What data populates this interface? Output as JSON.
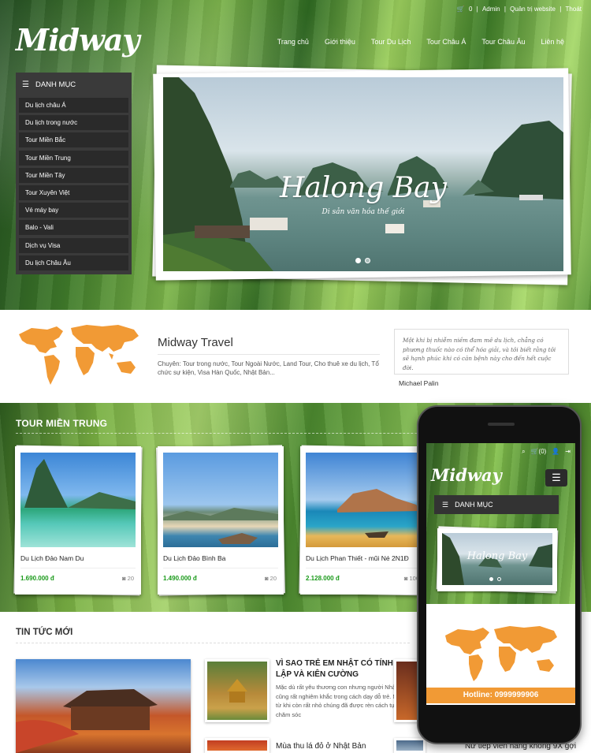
{
  "brand": {
    "logo": "Midway"
  },
  "topbar": {
    "cart_count": "0",
    "admin": "Admin",
    "site_admin": "Quản trị website",
    "logout": "Thoát"
  },
  "nav": [
    "Trang chủ",
    "Giới thiệu",
    "Tour Du Lịch",
    "Tour Châu Á",
    "Tour Châu Âu",
    "Liên hệ"
  ],
  "sidebar": {
    "title": "DANH MỤC",
    "items": [
      "Du lịch châu Á",
      "Du lịch trong nước",
      "Tour Miền Bắc",
      "Tour Miền Trung",
      "Tour Miền Tây",
      "Tour Xuyên Việt",
      "Vé máy bay",
      "Balo - Vali",
      "Dịch vụ Visa",
      "Du lịch Châu Âu"
    ]
  },
  "slider": {
    "title": "Halong Bay",
    "subtitle": "Di sản văn hóa thế giới"
  },
  "about": {
    "name": "Midway Travel",
    "desc": "Chuyên: Tour trong nước, Tour Ngoài Nước, Land Tour, Cho thuê xe du lịch, Tổ chức sự kiện, Visa Hàn Quốc, Nhật Bản..."
  },
  "quote": {
    "text": "Một khi bị nhiễm niềm đam mê du lịch, chẳng có phương thuốc nào có thể hóa giải, và tôi biết rằng tôi sẽ hạnh phúc khi có căn bệnh này cho đến hết cuộc đời.",
    "author": "Michael Palin"
  },
  "tours": {
    "title": "TOUR MIỀN TRUNG",
    "items": [
      {
        "name": "Du Lịch Đảo Nam Du",
        "price": "1.690.000 đ",
        "views": "20"
      },
      {
        "name": "Du Lịch Đảo Bình Ba",
        "price": "1.490.000 đ",
        "views": "20"
      },
      {
        "name": "Du Lịch Phan Thiết - mũi Né 2N1Đ",
        "price": "2.128.000 đ",
        "views": "100"
      }
    ]
  },
  "news": {
    "title": "TIN TỨC MỚI",
    "items": [
      {
        "title": "VÌ SAO TRẺ EM NHẬT CÓ TÍNH TỰ LẬP VÀ KIÊN CƯỜNG",
        "summary": "Mặc dù rất yêu thương con nhưng người Nhật cũng rất nghiêm khắc trong cách dạy dỗ trẻ. Ngay từ khi còn rất nhỏ chúng đã được rèn cách tự chăm sóc"
      },
      {
        "title": "Mùa thu lá đỏ ở Nhật Bản",
        "summary": ""
      },
      {
        "title": "Nữ tiếp viên hàng không 9X gợi",
        "summary": ""
      }
    ]
  },
  "mobile": {
    "logo": "Midway",
    "cart": "(0)",
    "menu_title": "DANH MỤC",
    "slider_title": "Halong Bay",
    "hotline": "Hotline: 0999999906"
  },
  "colors": {
    "accent": "#f19a35",
    "price": "#1a9a1a",
    "sidebar": "#3a3a3a"
  }
}
